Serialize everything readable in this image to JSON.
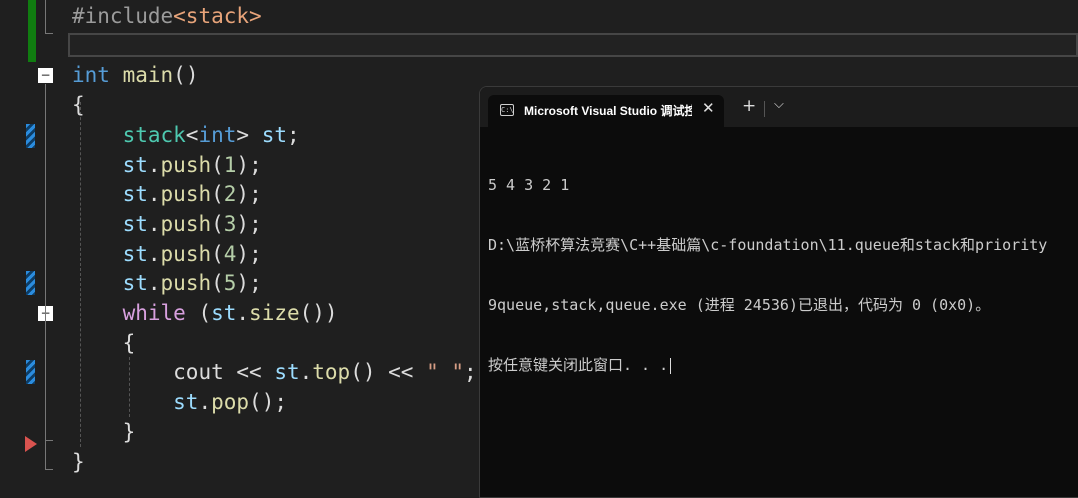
{
  "editor": {
    "lines": [
      {
        "tokens": [
          {
            "t": "#include",
            "c": "pp"
          },
          {
            "t": "<stack>",
            "c": "hdr"
          }
        ]
      },
      {
        "tokens": []
      },
      {
        "tokens": [
          {
            "t": "int",
            "c": "kw"
          },
          {
            "t": " ",
            "c": ""
          },
          {
            "t": "main",
            "c": "fn"
          },
          {
            "t": "()",
            "c": ""
          }
        ]
      },
      {
        "tokens": [
          {
            "t": "{",
            "c": ""
          }
        ]
      },
      {
        "tokens": [
          {
            "t": "    ",
            "c": ""
          },
          {
            "t": "stack",
            "c": "ty"
          },
          {
            "t": "<",
            "c": ""
          },
          {
            "t": "int",
            "c": "kw"
          },
          {
            "t": "> ",
            "c": ""
          },
          {
            "t": "st",
            "c": "var"
          },
          {
            "t": ";",
            "c": ""
          }
        ]
      },
      {
        "tokens": [
          {
            "t": "    ",
            "c": ""
          },
          {
            "t": "st",
            "c": "var"
          },
          {
            "t": ".",
            "c": ""
          },
          {
            "t": "push",
            "c": "fn"
          },
          {
            "t": "(",
            "c": ""
          },
          {
            "t": "1",
            "c": "num"
          },
          {
            "t": ");",
            "c": ""
          }
        ]
      },
      {
        "tokens": [
          {
            "t": "    ",
            "c": ""
          },
          {
            "t": "st",
            "c": "var"
          },
          {
            "t": ".",
            "c": ""
          },
          {
            "t": "push",
            "c": "fn"
          },
          {
            "t": "(",
            "c": ""
          },
          {
            "t": "2",
            "c": "num"
          },
          {
            "t": ");",
            "c": ""
          }
        ]
      },
      {
        "tokens": [
          {
            "t": "    ",
            "c": ""
          },
          {
            "t": "st",
            "c": "var"
          },
          {
            "t": ".",
            "c": ""
          },
          {
            "t": "push",
            "c": "fn"
          },
          {
            "t": "(",
            "c": ""
          },
          {
            "t": "3",
            "c": "num"
          },
          {
            "t": ");",
            "c": ""
          }
        ]
      },
      {
        "tokens": [
          {
            "t": "    ",
            "c": ""
          },
          {
            "t": "st",
            "c": "var"
          },
          {
            "t": ".",
            "c": ""
          },
          {
            "t": "push",
            "c": "fn"
          },
          {
            "t": "(",
            "c": ""
          },
          {
            "t": "4",
            "c": "num"
          },
          {
            "t": ");",
            "c": ""
          }
        ]
      },
      {
        "tokens": [
          {
            "t": "    ",
            "c": ""
          },
          {
            "t": "st",
            "c": "var"
          },
          {
            "t": ".",
            "c": ""
          },
          {
            "t": "push",
            "c": "fn"
          },
          {
            "t": "(",
            "c": ""
          },
          {
            "t": "5",
            "c": "num"
          },
          {
            "t": ");",
            "c": ""
          }
        ]
      },
      {
        "tokens": [
          {
            "t": "    ",
            "c": ""
          },
          {
            "t": "while",
            "c": "ctl"
          },
          {
            "t": " (",
            "c": ""
          },
          {
            "t": "st",
            "c": "var"
          },
          {
            "t": ".",
            "c": ""
          },
          {
            "t": "size",
            "c": "fn"
          },
          {
            "t": "())",
            "c": ""
          }
        ]
      },
      {
        "tokens": [
          {
            "t": "    {",
            "c": ""
          }
        ]
      },
      {
        "tokens": [
          {
            "t": "        ",
            "c": ""
          },
          {
            "t": "cout",
            "c": ""
          },
          {
            "t": " << ",
            "c": ""
          },
          {
            "t": "st",
            "c": "var"
          },
          {
            "t": ".",
            "c": ""
          },
          {
            "t": "top",
            "c": "fn"
          },
          {
            "t": "() << ",
            "c": ""
          },
          {
            "t": "\" \"",
            "c": "str"
          },
          {
            "t": ";",
            "c": ""
          }
        ]
      },
      {
        "tokens": [
          {
            "t": "        ",
            "c": ""
          },
          {
            "t": "st",
            "c": "var"
          },
          {
            "t": ".",
            "c": ""
          },
          {
            "t": "pop",
            "c": "fn"
          },
          {
            "t": "();",
            "c": ""
          }
        ]
      },
      {
        "tokens": [
          {
            "t": "    }",
            "c": ""
          }
        ]
      },
      {
        "tokens": [
          {
            "t": "}",
            "c": ""
          }
        ]
      }
    ],
    "fold_glyph": "−",
    "colors": {
      "background": "#1f1f1f",
      "keyword": "#569cd6",
      "control": "#d8a0df",
      "function": "#dcdcaa",
      "type": "#4ec9b0",
      "number": "#b5cea8",
      "string": "#d69d85",
      "variable": "#9cdcfe",
      "change_bar": "#107c10",
      "breakpoint_arrow": "#d9534f"
    }
  },
  "terminal": {
    "tab_title": "Microsoft Visual Studio 调试控",
    "close_glyph": "✕",
    "new_tab_glyph": "+",
    "dropdown_glyph": "⌵",
    "icon_label": "C:\\",
    "output_lines": [
      "5 4 3 2 1",
      "D:\\蓝桥杯算法竞赛\\C++基础篇\\c-foundation\\11.queue和stack和priority",
      "9queue,stack,queue.exe (进程 24536)已退出，代码为 0 (0x0)。",
      "按任意键关闭此窗口. . ."
    ],
    "colors": {
      "background": "#0c0c0c",
      "titlebar": "#1c1c1c",
      "text": "#cccccc"
    }
  }
}
